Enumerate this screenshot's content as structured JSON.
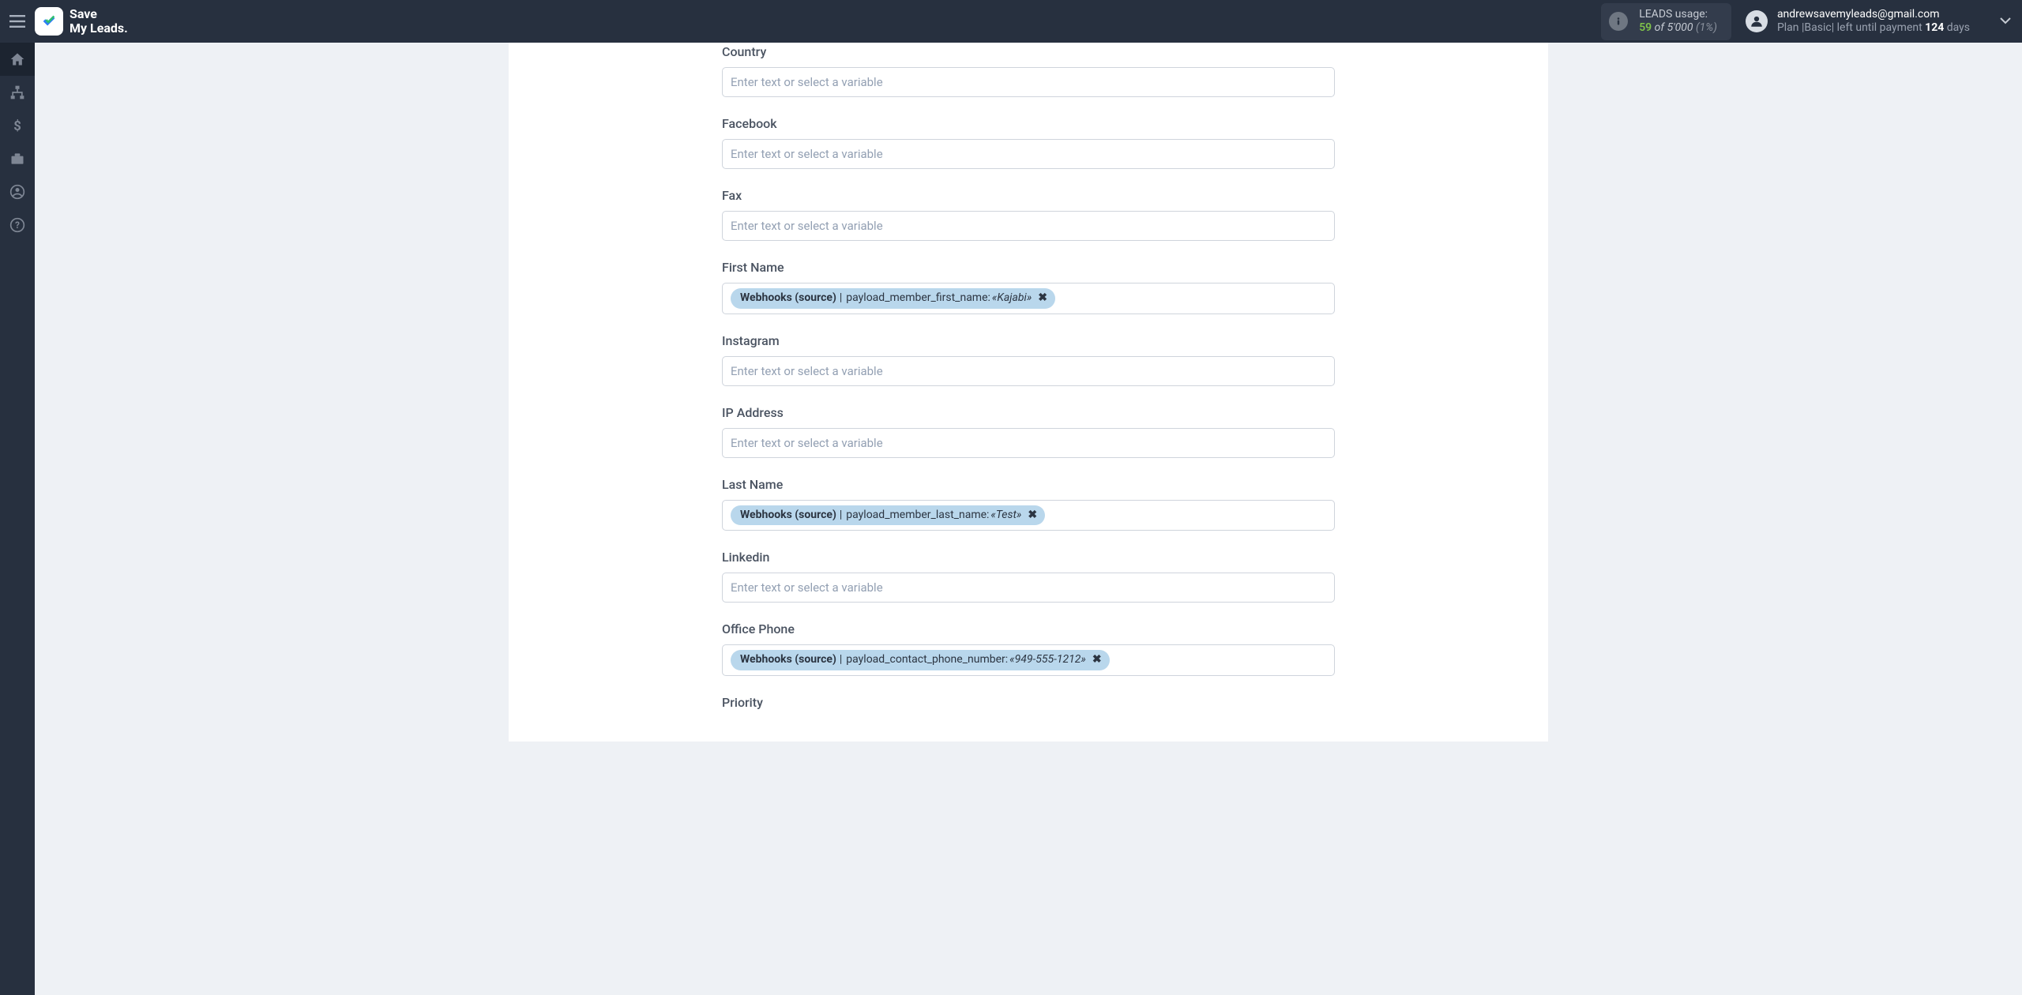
{
  "app": {
    "name_line1": "Save",
    "name_line2": "My Leads."
  },
  "usage": {
    "label": "LEADS usage:",
    "used": "59",
    "of_word": "of",
    "total": "5'000",
    "percent": "(1%)"
  },
  "profile": {
    "email": "andrewsavemyleads@gmail.com",
    "plan_prefix": "Plan |",
    "plan_name": "Basic",
    "plan_sep": "|",
    "plan_mid": " left until payment ",
    "days_num": "124",
    "days_word": " days"
  },
  "placeholders": {
    "default": "Enter text or select a variable"
  },
  "fields": [
    {
      "label": "Country",
      "tag": null
    },
    {
      "label": "Facebook",
      "tag": null
    },
    {
      "label": "Fax",
      "tag": null
    },
    {
      "label": "First Name",
      "tag": {
        "source": "Webhooks (source)",
        "key": "payload_member_first_name:",
        "value": "«Kajabi»"
      }
    },
    {
      "label": "Instagram",
      "tag": null
    },
    {
      "label": "IP Address",
      "tag": null
    },
    {
      "label": "Last Name",
      "tag": {
        "source": "Webhooks (source)",
        "key": "payload_member_last_name:",
        "value": "«Test»"
      }
    },
    {
      "label": "Linkedin",
      "tag": null
    },
    {
      "label": "Office Phone",
      "tag": {
        "source": "Webhooks (source)",
        "key": "payload_contact_phone_number:",
        "value": "«949-555-1212»"
      }
    },
    {
      "label": "Priority",
      "tag": null,
      "label_only": true
    }
  ]
}
